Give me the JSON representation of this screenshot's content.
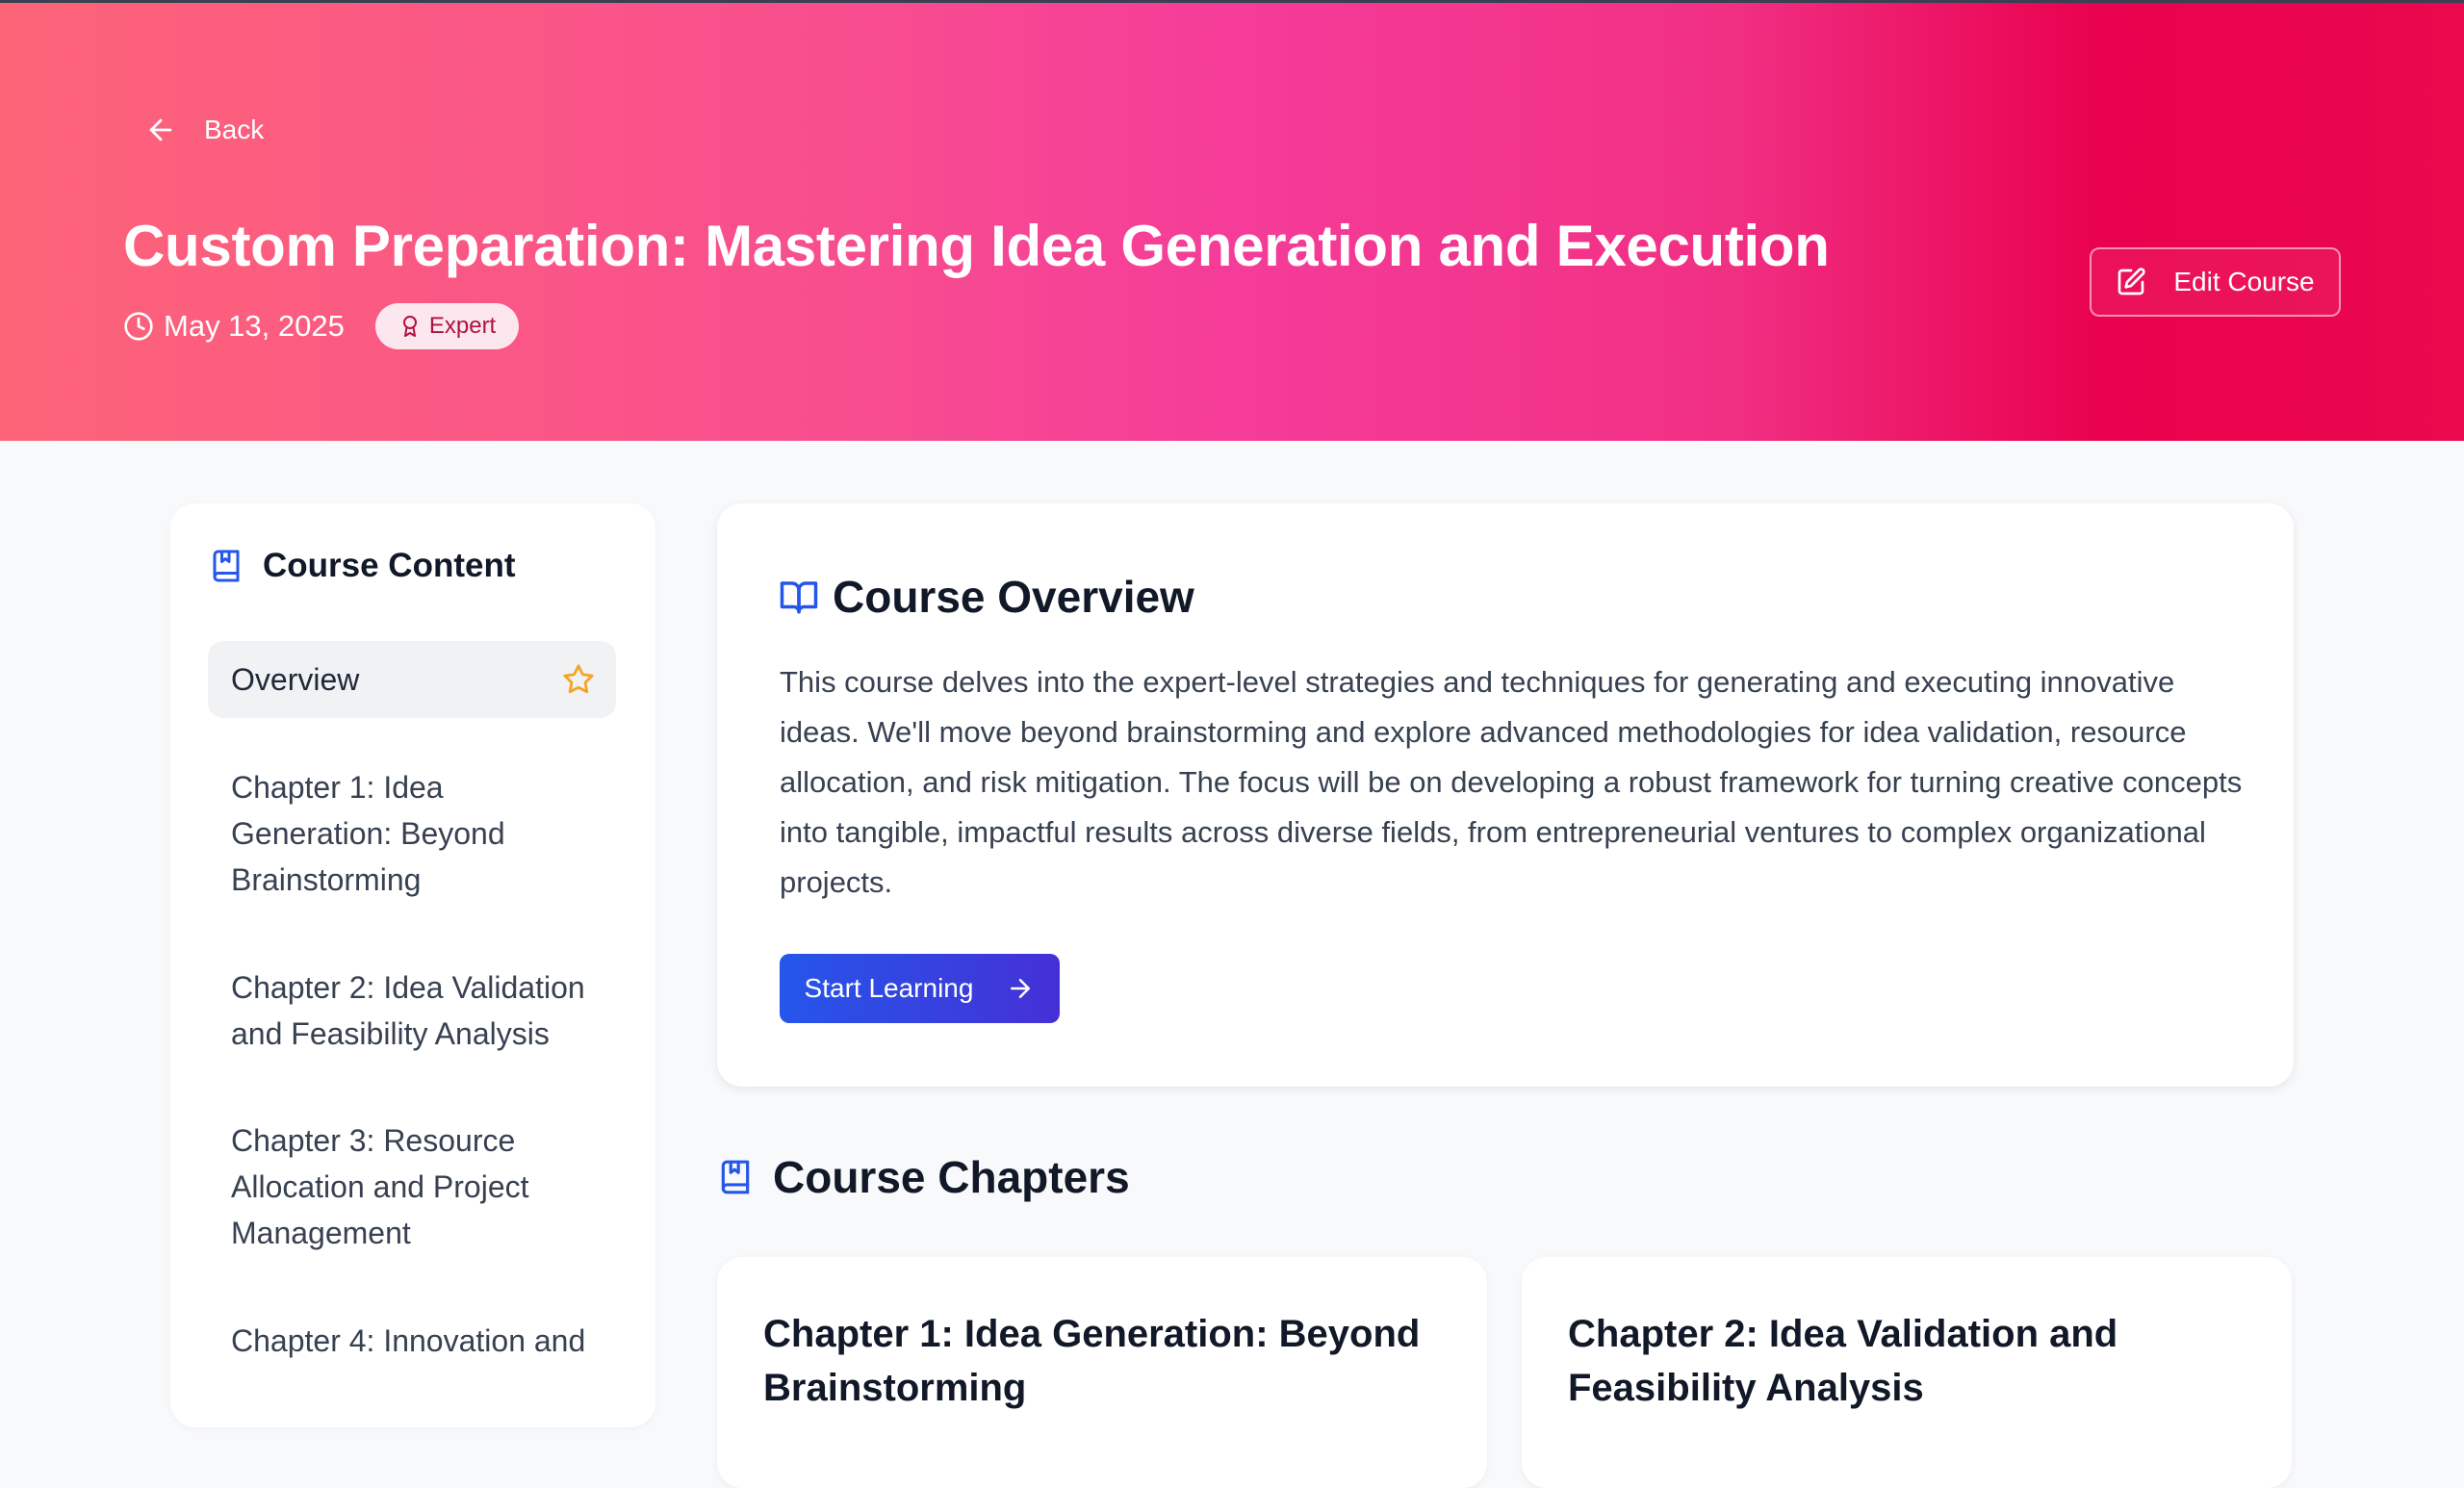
{
  "header": {
    "back_label": "Back",
    "title": "Custom Preparation: Mastering Idea Generation and Execution",
    "date": "May 13, 2025",
    "level_badge": "Expert",
    "edit_label": "Edit Course"
  },
  "sidebar": {
    "title": "Course Content",
    "items": [
      {
        "label": "Overview",
        "active": true
      },
      {
        "label": "Chapter 1: Idea Generation: Beyond Brainstorming"
      },
      {
        "label": "Chapter 2: Idea Validation and Feasibility Analysis"
      },
      {
        "label": "Chapter 3: Resource Allocation and Project Management"
      },
      {
        "label": "Chapter 4: Innovation and"
      }
    ]
  },
  "overview": {
    "title": "Course Overview",
    "description": "This course delves into the expert-level strategies and techniques for generating and executing innovative ideas.  We'll move beyond brainstorming and explore advanced methodologies for idea validation, resource allocation, and risk mitigation.  The focus will be on developing a robust framework for turning creative concepts into tangible, impactful results across diverse fields, from entrepreneurial ventures to complex organizational projects.",
    "start_label": "Start Learning"
  },
  "chapters": {
    "title": "Course Chapters",
    "cards": [
      {
        "title": "Chapter 1: Idea Generation: Beyond Brainstorming"
      },
      {
        "title": "Chapter 2: Idea Validation and Feasibility Analysis"
      }
    ]
  },
  "colors": {
    "hero_gradient_start": "#fd6478",
    "hero_gradient_end": "#eb084d",
    "accent_blue": "#2556ea",
    "star": "#f5a524"
  },
  "icons": [
    "arrow-left-icon",
    "clock-icon",
    "award-icon",
    "edit-icon",
    "book-icon",
    "star-icon",
    "book-open-icon",
    "arrow-right-icon"
  ]
}
